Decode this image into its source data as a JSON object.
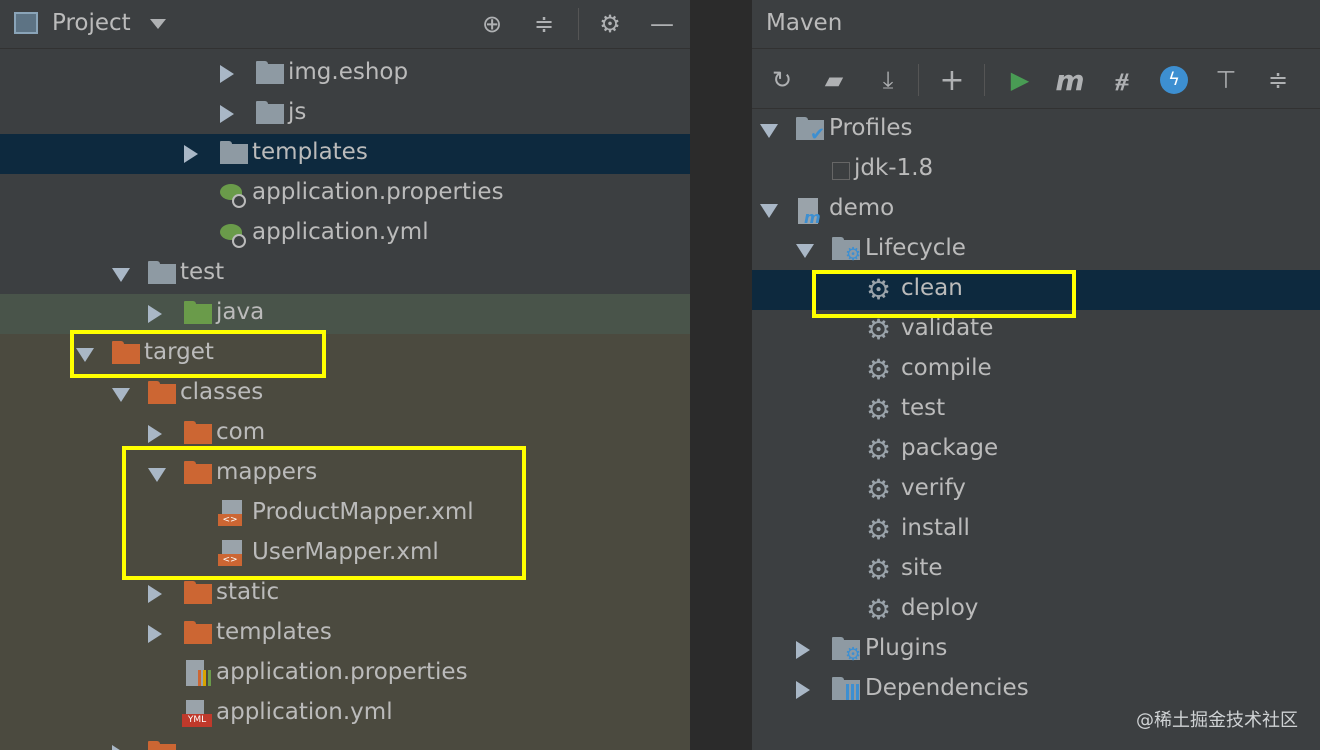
{
  "project": {
    "title": "Project",
    "header_icons": [
      "target-icon",
      "collapse-icon",
      "gear-icon",
      "minimize-icon"
    ],
    "tree": [
      {
        "label": "img.eshop",
        "icon": "folder-gray",
        "arrow": "right"
      },
      {
        "label": "js",
        "icon": "folder-gray",
        "arrow": "right"
      },
      {
        "label": "templates",
        "icon": "folder-gray",
        "arrow": "right",
        "selected": true
      },
      {
        "label": "application.properties",
        "icon": "spring-config"
      },
      {
        "label": "application.yml",
        "icon": "spring-config"
      },
      {
        "label": "test",
        "icon": "folder-gray",
        "arrow": "down"
      },
      {
        "label": "java",
        "icon": "folder-green",
        "arrow": "right"
      },
      {
        "label": "target",
        "icon": "folder-orange",
        "arrow": "down"
      },
      {
        "label": "classes",
        "icon": "folder-orange",
        "arrow": "down"
      },
      {
        "label": "com",
        "icon": "folder-orange",
        "arrow": "right"
      },
      {
        "label": "mappers",
        "icon": "folder-orange",
        "arrow": "down"
      },
      {
        "label": "ProductMapper.xml",
        "icon": "xml-file"
      },
      {
        "label": "UserMapper.xml",
        "icon": "xml-file"
      },
      {
        "label": "static",
        "icon": "folder-orange",
        "arrow": "right"
      },
      {
        "label": "templates",
        "icon": "folder-orange",
        "arrow": "right"
      },
      {
        "label": "application.properties",
        "icon": "properties-file"
      },
      {
        "label": "application.yml",
        "icon": "yml-file"
      }
    ]
  },
  "maven": {
    "title": "Maven",
    "toolbar": [
      "reload-icon",
      "add-folder-icon",
      "download-icon",
      "plus-icon",
      "run-icon",
      "maven-m-icon",
      "skip-tests-icon",
      "offline-icon",
      "expand-all-icon",
      "collapse-all-icon"
    ],
    "profiles_label": "Profiles",
    "jdk_label": "jdk-1.8",
    "demo_label": "demo",
    "lifecycle_label": "Lifecycle",
    "lifecycle": [
      "clean",
      "validate",
      "compile",
      "test",
      "package",
      "verify",
      "install",
      "site",
      "deploy"
    ],
    "plugins_label": "Plugins",
    "dependencies_label": "Dependencies"
  },
  "colors": {
    "panel_bg": "#3c3f41",
    "selection": "#0d293e",
    "highlight_box": "#ffff00",
    "test_area_bg": "#49544a",
    "target_area_bg": "#4b4a3f"
  },
  "watermark": "@稀土掘金技术社区"
}
